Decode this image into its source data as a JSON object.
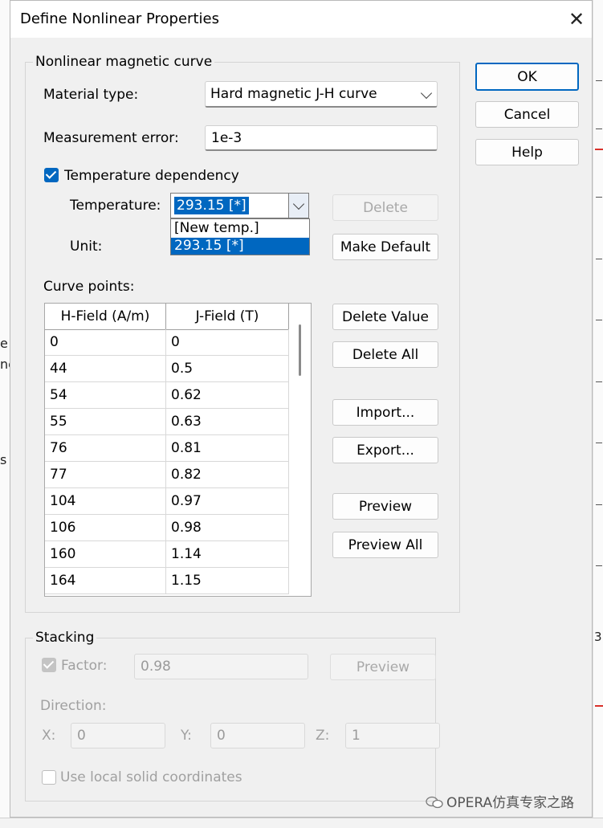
{
  "dialog": {
    "title": "Define Nonlinear Properties",
    "close_glyph": "✕"
  },
  "buttons": {
    "ok": "OK",
    "cancel": "Cancel",
    "help": "Help"
  },
  "nonlinear": {
    "group_label": "Nonlinear magnetic curve",
    "material_type_label": "Material type:",
    "material_type_value": "Hard magnetic J-H curve",
    "measurement_error_label": "Measurement error:",
    "measurement_error_value": "1e-3",
    "temperature_dependency_label": "Temperature dependency",
    "temperature_dependency_checked": true,
    "temperature_label": "Temperature:",
    "temperature_value": "293.15 [*]",
    "temperature_options": [
      "[New temp.]",
      "293.15 [*]"
    ],
    "temperature_selected_index": 1,
    "delete_label": "Delete",
    "unit_label": "Unit:",
    "make_default_label": "Make Default",
    "curve_points_label": "Curve points:",
    "table": {
      "columns": [
        "H-Field (A/m)",
        "J-Field (T)"
      ],
      "rows": [
        [
          "0",
          "0"
        ],
        [
          "44",
          "0.5"
        ],
        [
          "54",
          "0.62"
        ],
        [
          "55",
          "0.63"
        ],
        [
          "76",
          "0.81"
        ],
        [
          "77",
          "0.82"
        ],
        [
          "104",
          "0.97"
        ],
        [
          "106",
          "0.98"
        ],
        [
          "160",
          "1.14"
        ],
        [
          "164",
          "1.15"
        ]
      ]
    },
    "delete_value_label": "Delete Value",
    "delete_all_label": "Delete All",
    "import_label": "Import...",
    "export_label": "Export...",
    "preview_label": "Preview",
    "preview_all_label": "Preview All"
  },
  "stacking": {
    "group_label": "Stacking",
    "factor_label": "Factor:",
    "factor_checked": true,
    "factor_value": "0.98",
    "preview_label": "Preview",
    "direction_label": "Direction:",
    "x_label": "X:",
    "x_value": "0",
    "y_label": "Y:",
    "y_value": "0",
    "z_label": "Z:",
    "z_value": "1",
    "use_local_label": "Use local solid coordinates",
    "use_local_checked": false
  },
  "background": {
    "left_fragments": [
      "e",
      "ne",
      "s"
    ],
    "right_fragment": "3"
  },
  "watermark": {
    "text": "OPERA仿真专家之路"
  },
  "colors": {
    "accent": "#0067c0",
    "dialog_bg": "#f0f0f0",
    "disabled_text": "#a0a0a0"
  }
}
